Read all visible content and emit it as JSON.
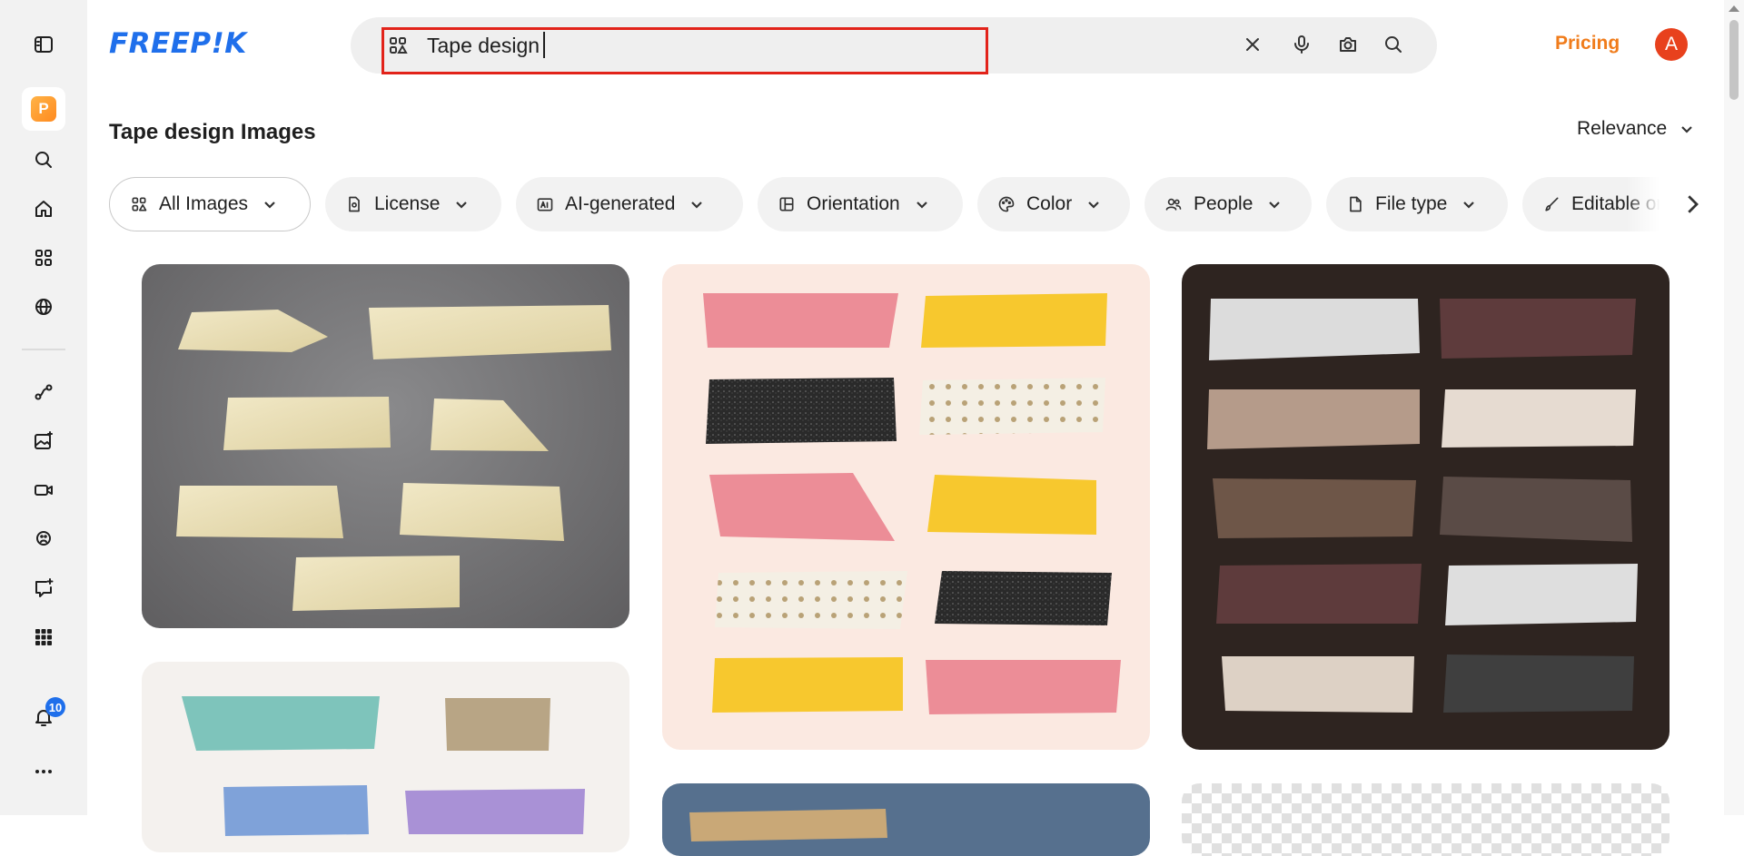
{
  "brand": {
    "logo_text": "FREEP!K",
    "logo_color": "#1f6feb"
  },
  "search": {
    "value": "Tape design",
    "placeholder": ""
  },
  "header": {
    "pricing_label": "Pricing",
    "avatar_initial": "A",
    "accent": "#f07c1b"
  },
  "sidebar": {
    "notification_count": "10"
  },
  "page": {
    "title": "Tape design Images",
    "sort_label": "Relevance"
  },
  "filters": [
    {
      "label": "All Images",
      "icon": "grid-icon"
    },
    {
      "label": "License",
      "icon": "license-icon"
    },
    {
      "label": "AI-generated",
      "icon": "ai-icon"
    },
    {
      "label": "Orientation",
      "icon": "orientation-icon"
    },
    {
      "label": "Color",
      "icon": "palette-icon"
    },
    {
      "label": "People",
      "icon": "people-icon"
    },
    {
      "label": "File type",
      "icon": "file-icon"
    },
    {
      "label": "Editable online",
      "icon": "brush-icon"
    }
  ],
  "colors": {
    "card1_bg": "#6b6b6d",
    "card2_bg": "#fbe9e1",
    "card3_bg": "#2e2420",
    "card4_bg": "#f4f1ee",
    "card5_bg": "#56708e"
  }
}
